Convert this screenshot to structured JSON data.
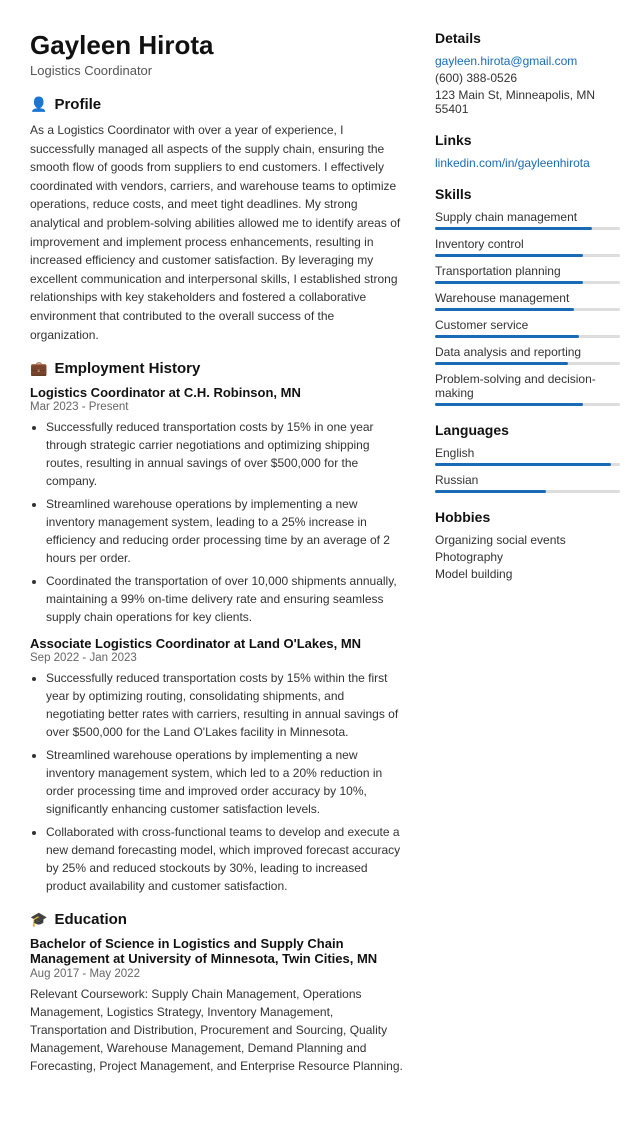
{
  "header": {
    "name": "Gayleen Hirota",
    "title": "Logistics Coordinator"
  },
  "profile": {
    "section_title": "Profile",
    "text": "As a Logistics Coordinator with over a year of experience, I successfully managed all aspects of the supply chain, ensuring the smooth flow of goods from suppliers to end customers. I effectively coordinated with vendors, carriers, and warehouse teams to optimize operations, reduce costs, and meet tight deadlines. My strong analytical and problem-solving abilities allowed me to identify areas of improvement and implement process enhancements, resulting in increased efficiency and customer satisfaction. By leveraging my excellent communication and interpersonal skills, I established strong relationships with key stakeholders and fostered a collaborative environment that contributed to the overall success of the organization."
  },
  "employment": {
    "section_title": "Employment History",
    "jobs": [
      {
        "title": "Logistics Coordinator at C.H. Robinson, MN",
        "dates": "Mar 2023 - Present",
        "bullets": [
          "Successfully reduced transportation costs by 15% in one year through strategic carrier negotiations and optimizing shipping routes, resulting in annual savings of over $500,000 for the company.",
          "Streamlined warehouse operations by implementing a new inventory management system, leading to a 25% increase in efficiency and reducing order processing time by an average of 2 hours per order.",
          "Coordinated the transportation of over 10,000 shipments annually, maintaining a 99% on-time delivery rate and ensuring seamless supply chain operations for key clients."
        ]
      },
      {
        "title": "Associate Logistics Coordinator at Land O'Lakes, MN",
        "dates": "Sep 2022 - Jan 2023",
        "bullets": [
          "Successfully reduced transportation costs by 15% within the first year by optimizing routing, consolidating shipments, and negotiating better rates with carriers, resulting in annual savings of over $500,000 for the Land O'Lakes facility in Minnesota.",
          "Streamlined warehouse operations by implementing a new inventory management system, which led to a 20% reduction in order processing time and improved order accuracy by 10%, significantly enhancing customer satisfaction levels.",
          "Collaborated with cross-functional teams to develop and execute a new demand forecasting model, which improved forecast accuracy by 25% and reduced stockouts by 30%, leading to increased product availability and customer satisfaction."
        ]
      }
    ]
  },
  "education": {
    "section_title": "Education",
    "degree": "Bachelor of Science in Logistics and Supply Chain Management at University of Minnesota, Twin Cities, MN",
    "dates": "Aug 2017 - May 2022",
    "text": "Relevant Coursework: Supply Chain Management, Operations Management, Logistics Strategy, Inventory Management, Transportation and Distribution, Procurement and Sourcing, Quality Management, Warehouse Management, Demand Planning and Forecasting, Project Management, and Enterprise Resource Planning."
  },
  "details": {
    "section_title": "Details",
    "email": "gayleen.hirota@gmail.com",
    "phone": "(600) 388-0526",
    "address": "123 Main St, Minneapolis, MN 55401"
  },
  "links": {
    "section_title": "Links",
    "linkedin": "linkedin.com/in/gayleenhirota"
  },
  "skills": {
    "section_title": "Skills",
    "items": [
      {
        "label": "Supply chain management",
        "pct": 85
      },
      {
        "label": "Inventory control",
        "pct": 80
      },
      {
        "label": "Transportation planning",
        "pct": 80
      },
      {
        "label": "Warehouse management",
        "pct": 75
      },
      {
        "label": "Customer service",
        "pct": 78
      },
      {
        "label": "Data analysis and reporting",
        "pct": 72
      },
      {
        "label": "Problem-solving and decision-making",
        "pct": 80
      }
    ]
  },
  "languages": {
    "section_title": "Languages",
    "items": [
      {
        "label": "English",
        "pct": 95
      },
      {
        "label": "Russian",
        "pct": 60
      }
    ]
  },
  "hobbies": {
    "section_title": "Hobbies",
    "items": [
      "Organizing social events",
      "Photography",
      "Model building"
    ]
  }
}
